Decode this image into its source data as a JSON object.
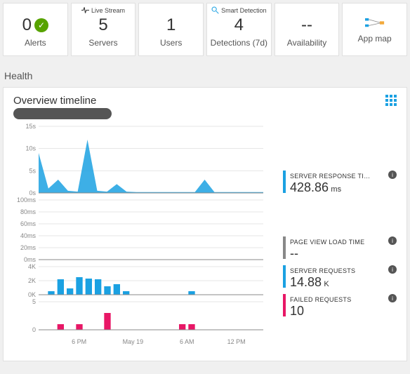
{
  "tiles": {
    "alerts": {
      "value": "0",
      "label": "Alerts"
    },
    "livestream": {
      "top": "Live Stream",
      "value": "5",
      "label": "Servers"
    },
    "users": {
      "value": "1",
      "label": "Users"
    },
    "smart": {
      "top": "Smart Detection",
      "value": "4",
      "label": "Detections (7d)"
    },
    "availability": {
      "value": "--",
      "label": "Availability"
    },
    "appmap": {
      "label": "App map"
    }
  },
  "health": {
    "title": "Health"
  },
  "panel": {
    "title": "Overview timeline"
  },
  "stats": {
    "response": {
      "label": "SERVER RESPONSE TI…",
      "value": "428.86",
      "unit": "ms",
      "color": "#1ba1e2"
    },
    "pageview": {
      "label": "PAGE VIEW LOAD TIME",
      "value": "--",
      "unit": "",
      "color": "#888"
    },
    "requests": {
      "label": "SERVER REQUESTS",
      "value": "14.88",
      "unit": "K",
      "color": "#1ba1e2"
    },
    "failed": {
      "label": "FAILED REQUESTS",
      "value": "10",
      "unit": "",
      "color": "#e81766"
    }
  },
  "chart_data": [
    {
      "type": "area",
      "title": "Server response time",
      "ylabel": "",
      "ylim": [
        0,
        15
      ],
      "yunit": "s",
      "yticks": [
        0,
        5,
        10,
        15
      ],
      "x": [
        0,
        1,
        2,
        3,
        4,
        5,
        6,
        7,
        8,
        9,
        10,
        11,
        12,
        13,
        14,
        15,
        16,
        17,
        18,
        19,
        20,
        21,
        22,
        23
      ],
      "values": [
        9,
        1,
        3,
        0.5,
        0.3,
        12,
        0.5,
        0.3,
        2,
        0.3,
        0.2,
        0.2,
        0.2,
        0.2,
        0.2,
        0.2,
        0.2,
        3,
        0.2,
        0.2,
        0.2,
        0.2,
        0.2,
        0.2
      ],
      "color": "#1ba1e2"
    },
    {
      "type": "line",
      "title": "Page view load time",
      "ylabel": "",
      "ylim": [
        0,
        100
      ],
      "yunit": "ms",
      "yticks": [
        0,
        20,
        40,
        60,
        80,
        100
      ],
      "values": [],
      "color": "#888"
    },
    {
      "type": "bar",
      "title": "Server requests",
      "ylabel": "",
      "ylim": [
        0,
        4
      ],
      "yunit": "K",
      "yticks": [
        0,
        2,
        4
      ],
      "x": [
        0,
        1,
        2,
        3,
        4,
        5,
        6,
        7,
        8,
        9,
        10,
        11,
        12,
        13,
        14,
        15,
        16,
        17,
        18,
        19,
        20,
        21,
        22,
        23
      ],
      "values": [
        0,
        0.5,
        2.2,
        0.9,
        2.5,
        2.3,
        2.2,
        1.2,
        1.5,
        0.5,
        0,
        0,
        0,
        0,
        0,
        0,
        0.5,
        0,
        0,
        0,
        0,
        0,
        0,
        0
      ],
      "color": "#1ba1e2"
    },
    {
      "type": "bar",
      "title": "Failed requests",
      "ylabel": "",
      "ylim": [
        0,
        5
      ],
      "yunit": "",
      "yticks": [
        0,
        5
      ],
      "x": [
        0,
        1,
        2,
        3,
        4,
        5,
        6,
        7,
        8,
        9,
        10,
        11,
        12,
        13,
        14,
        15,
        16,
        17,
        18,
        19,
        20,
        21,
        22,
        23
      ],
      "values": [
        0,
        0,
        1,
        0,
        1,
        0,
        0,
        3,
        0,
        0,
        0,
        0,
        0,
        0,
        0,
        1,
        1,
        0,
        0,
        0,
        0,
        0,
        0,
        0
      ],
      "color": "#e81766"
    }
  ],
  "xaxis": {
    "labels": [
      "6 PM",
      "May 19",
      "6 AM",
      "12 PM"
    ],
    "positions": [
      0.18,
      0.42,
      0.66,
      0.88
    ]
  }
}
